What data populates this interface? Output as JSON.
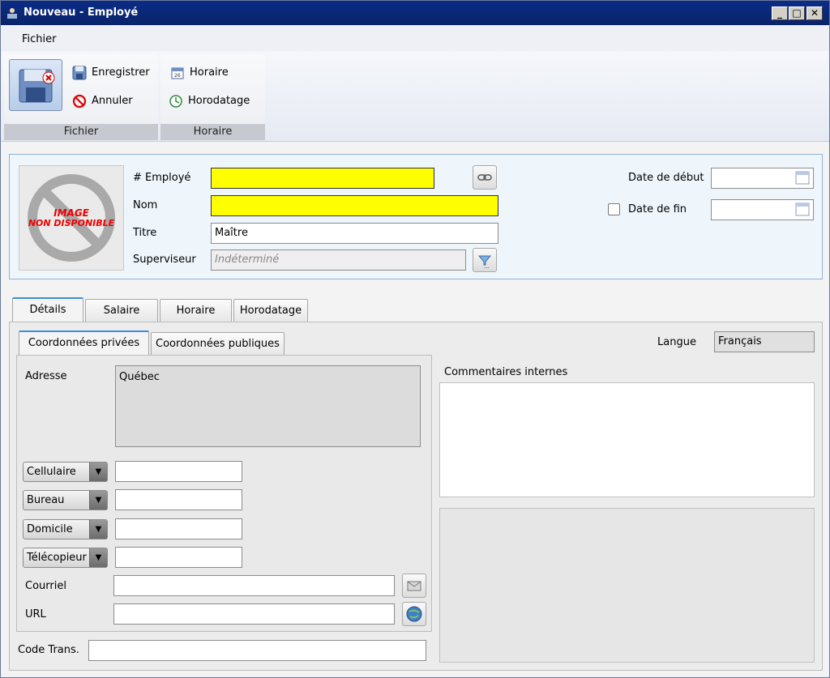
{
  "window": {
    "title": "Nouveau - Employé",
    "controls": {
      "minimize": "_",
      "maximize": "□",
      "close": "✕"
    }
  },
  "menu": {
    "items": [
      "Fichier"
    ]
  },
  "ribbon": {
    "groups": [
      {
        "label": "Fichier",
        "buttons": [
          "Enregistrer",
          "Annuler"
        ]
      },
      {
        "label": "Horaire",
        "buttons": [
          "Horaire",
          "Horodatage"
        ]
      }
    ]
  },
  "header": {
    "photo_text_line1": "IMAGE",
    "photo_text_line2": "NON DISPONIBLE",
    "employee_no_label": "# Employé",
    "employee_no_value": "",
    "name_label": "Nom",
    "name_value": "",
    "title_label": "Titre",
    "title_value": "Maître",
    "supervisor_label": "Superviseur",
    "supervisor_value": "Indéterminé",
    "start_date_label": "Date de début",
    "start_date_value": "",
    "end_date_label": "Date de fin",
    "end_date_checked": false,
    "end_date_value": ""
  },
  "tabs": [
    "Détails",
    "Salaire",
    "Horaire",
    "Horodatage"
  ],
  "active_tab": "Détails",
  "details": {
    "subtabs": [
      "Coordonnées privées",
      "Coordonnées publiques"
    ],
    "active_subtab": "Coordonnées privées",
    "language_label": "Langue",
    "language_value": "Français",
    "address_label": "Adresse",
    "address_value": "Québec",
    "phones": [
      {
        "type": "Cellulaire",
        "value": ""
      },
      {
        "type": "Bureau",
        "value": ""
      },
      {
        "type": "Domicile",
        "value": ""
      },
      {
        "type": "Télécopieur",
        "value": ""
      }
    ],
    "email_label": "Courriel",
    "email_value": "",
    "url_label": "URL",
    "url_value": "",
    "code_trans_label": "Code Trans.",
    "code_trans_value": "",
    "comments_label": "Commentaires internes",
    "comments_value": ""
  }
}
